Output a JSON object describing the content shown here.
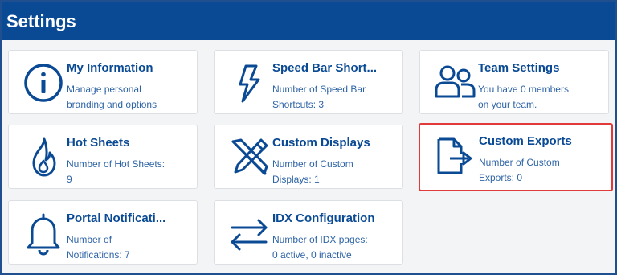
{
  "header": {
    "title": "Settings"
  },
  "colors": {
    "brand": "#0a4a94",
    "text_secondary": "#2e64a6",
    "highlight": "#e23a3a"
  },
  "cards": {
    "my_information": {
      "icon": "info-icon",
      "title": "My Information",
      "desc_line1": "Manage personal",
      "desc_line2": "branding and options"
    },
    "speed_bar": {
      "icon": "lightning-icon",
      "title": "Speed Bar Short...",
      "desc_line1": "Number of Speed Bar",
      "desc_line2": "Shortcuts: 3"
    },
    "team_settings": {
      "icon": "people-icon",
      "title": "Team Settings",
      "desc_line1": "You have 0 members",
      "desc_line2": "on your team."
    },
    "hot_sheets": {
      "icon": "flame-icon",
      "title": "Hot Sheets",
      "desc_line1": "Number of Hot Sheets:",
      "desc_line2": "9"
    },
    "custom_displays": {
      "icon": "design-tools-icon",
      "title": "Custom Displays",
      "desc_line1": "Number of Custom",
      "desc_line2": "Displays: 1"
    },
    "custom_exports": {
      "icon": "file-export-icon",
      "title": "Custom Exports",
      "desc_line1": "Number of Custom",
      "desc_line2": "Exports: 0"
    },
    "portal_notifications": {
      "icon": "bell-icon",
      "title": "Portal Notificati...",
      "desc_line1": "Number of",
      "desc_line2": "Notifications: 7"
    },
    "idx_configuration": {
      "icon": "transfer-arrows-icon",
      "title": "IDX Configuration",
      "desc_line1": "Number of IDX pages:",
      "desc_line2": "0 active, 0 inactive"
    }
  }
}
